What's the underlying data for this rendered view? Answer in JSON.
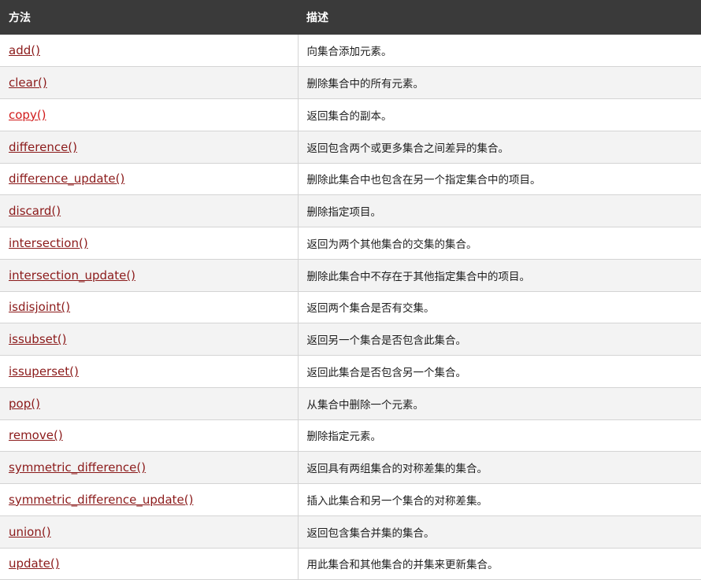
{
  "header": {
    "col_method": "方法",
    "col_desc": "描述"
  },
  "rows": [
    {
      "method": "add()",
      "desc": "向集合添加元素。"
    },
    {
      "method": "clear()",
      "desc": "删除集合中的所有元素。"
    },
    {
      "method": "copy()",
      "desc": "返回集合的副本。"
    },
    {
      "method": "difference()",
      "desc": "返回包含两个或更多集合之间差异的集合。"
    },
    {
      "method": "difference_update()",
      "desc": "删除此集合中也包含在另一个指定集合中的项目。"
    },
    {
      "method": "discard()",
      "desc": "删除指定项目。"
    },
    {
      "method": "intersection()",
      "desc": "返回为两个其他集合的交集的集合。"
    },
    {
      "method": "intersection_update()",
      "desc": "删除此集合中不存在于其他指定集合中的项目。"
    },
    {
      "method": "isdisjoint()",
      "desc": "返回两个集合是否有交集。"
    },
    {
      "method": "issubset()",
      "desc": "返回另一个集合是否包含此集合。"
    },
    {
      "method": "issuperset()",
      "desc": "返回此集合是否包含另一个集合。"
    },
    {
      "method": "pop()",
      "desc": "从集合中删除一个元素。"
    },
    {
      "method": "remove()",
      "desc": "删除指定元素。"
    },
    {
      "method": "symmetric_difference()",
      "desc": "返回具有两组集合的对称差集的集合。"
    },
    {
      "method": "symmetric_difference_update()",
      "desc": "插入此集合和另一个集合的对称差集。"
    },
    {
      "method": "union()",
      "desc": "返回包含集合并集的集合。"
    },
    {
      "method": "update()",
      "desc": "用此集合和其他集合的并集来更新集合。"
    }
  ],
  "colors": {
    "header_bg": "#3a3a3a",
    "link": "#8b1a1a",
    "link_active": "#d11a1a",
    "stripe": "#f3f3f3"
  },
  "active_link": "copy()"
}
